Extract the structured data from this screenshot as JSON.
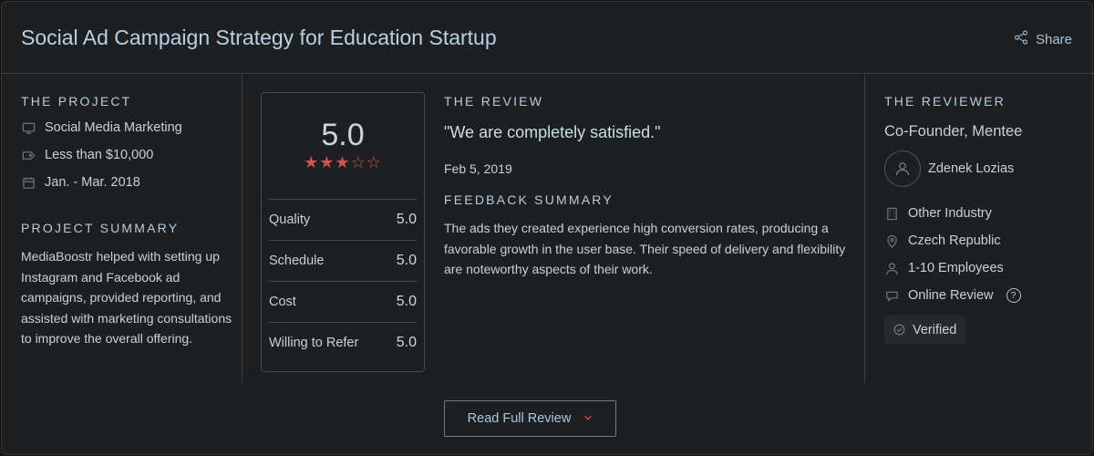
{
  "header": {
    "title": "Social Ad Campaign Strategy for Education Startup",
    "share_label": "Share"
  },
  "project": {
    "label": "THE PROJECT",
    "items": [
      {
        "icon": "monitor-icon",
        "text": "Social Media Marketing"
      },
      {
        "icon": "price-tag-icon",
        "text": "Less than $10,000"
      },
      {
        "icon": "calendar-icon",
        "text": "Jan. - Mar. 2018"
      }
    ],
    "summary_label": "PROJECT SUMMARY",
    "summary": "MediaBoostr helped with setting up Instagram and Facebook ad campaigns, provided reporting, and assisted with marketing consultations to improve the overall offering."
  },
  "scores": {
    "overall": "5.0",
    "stars": "★★★☆☆",
    "rows": [
      {
        "label": "Quality",
        "value": "5.0"
      },
      {
        "label": "Schedule",
        "value": "5.0"
      },
      {
        "label": "Cost",
        "value": "5.0"
      },
      {
        "label": "Willing to Refer",
        "value": "5.0"
      }
    ]
  },
  "review": {
    "label": "THE REVIEW",
    "quote": "\"We are completely satisfied.\"",
    "date": "Feb 5, 2019",
    "feedback_label": "FEEDBACK SUMMARY",
    "feedback": "The ads they created experience high conversion rates, producing a favorable growth in the user base. Their speed of delivery and flexibility are noteworthy aspects of their work."
  },
  "reviewer": {
    "label": "THE REVIEWER",
    "role": "Co-Founder, Mentee",
    "name": "Zdenek Lozias",
    "details": [
      {
        "icon": "building-icon",
        "text": "Other Industry"
      },
      {
        "icon": "location-pin-icon",
        "text": "Czech Republic"
      },
      {
        "icon": "person-icon",
        "text": "1-10 Employees"
      },
      {
        "icon": "chat-bubble-icon",
        "text": "Online Review"
      }
    ],
    "help_glyph": "?",
    "verified_label": "Verified"
  },
  "actions": {
    "read_full_review": "Read Full Review"
  },
  "colors": {
    "accent_star": "#d2544a",
    "title": "#b5d2e6",
    "background": "#1e1f21"
  }
}
